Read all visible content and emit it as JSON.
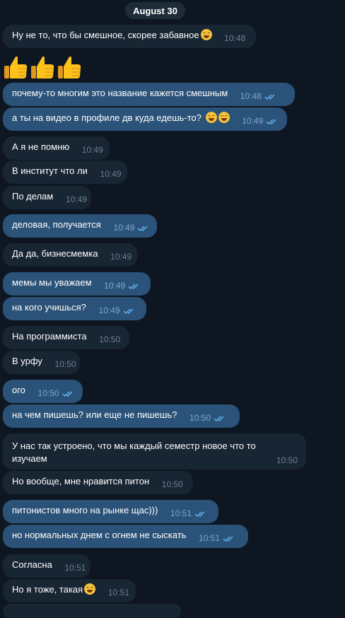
{
  "date_label": "August 30",
  "stickers": [
    "thumbs-up-emoji",
    "thumbs-up-emoji",
    "thumbs-up-emoji"
  ],
  "colors": {
    "bg": "#0e1621",
    "incoming": "#182533",
    "outgoing": "#2b5278",
    "accent": "#64b5ef"
  },
  "messages": [
    {
      "text": "Ну не то, что бы смешное, скорее забавное",
      "time": "10:48",
      "dir": "in",
      "emoji": "grin-sweat"
    },
    {
      "text": "почему-то многим это название кажется смешным",
      "time": "10:48",
      "dir": "out"
    },
    {
      "text": "а ты на видео в профиле дв куда едешь-то?",
      "time": "10:49",
      "dir": "out",
      "emoji": "grin x2"
    },
    {
      "text": "А я не помню",
      "time": "10:49",
      "dir": "in"
    },
    {
      "text": "В институт что ли",
      "time": "10:49",
      "dir": "in"
    },
    {
      "text": "По делам",
      "time": "10:49",
      "dir": "in"
    },
    {
      "text": "деловая, получается",
      "time": "10:49",
      "dir": "out"
    },
    {
      "text": "Да да, бизнесмемка",
      "time": "10:49",
      "dir": "in"
    },
    {
      "text": "мемы мы уважаем",
      "time": "10:49",
      "dir": "out"
    },
    {
      "text": "на кого учишься?",
      "time": "10:49",
      "dir": "out"
    },
    {
      "text": "На программиста",
      "time": "10:50",
      "dir": "in"
    },
    {
      "text": "В урфу",
      "time": "10:50",
      "dir": "in"
    },
    {
      "text": "ого",
      "time": "10:50",
      "dir": "out"
    },
    {
      "text": "на чем пишешь? или еще не пишешь?",
      "time": "10:50",
      "dir": "out"
    },
    {
      "text": "У нас так устроено, что мы каждый семестр новое что то изучаем",
      "time": "10:50",
      "dir": "in"
    },
    {
      "text": "Но вообще, мне нравится питон",
      "time": "10:50",
      "dir": "in"
    },
    {
      "text": "питонистов много на рынке щас)))",
      "time": "10:51",
      "dir": "out"
    },
    {
      "text": "но нормальных днем с огнем не сыскать",
      "time": "10:51",
      "dir": "out"
    },
    {
      "text": "Согласна",
      "time": "10:51",
      "dir": "in"
    },
    {
      "text": "Но я тоже, такая",
      "time": "10:51",
      "dir": "in",
      "emoji": "joy"
    }
  ]
}
